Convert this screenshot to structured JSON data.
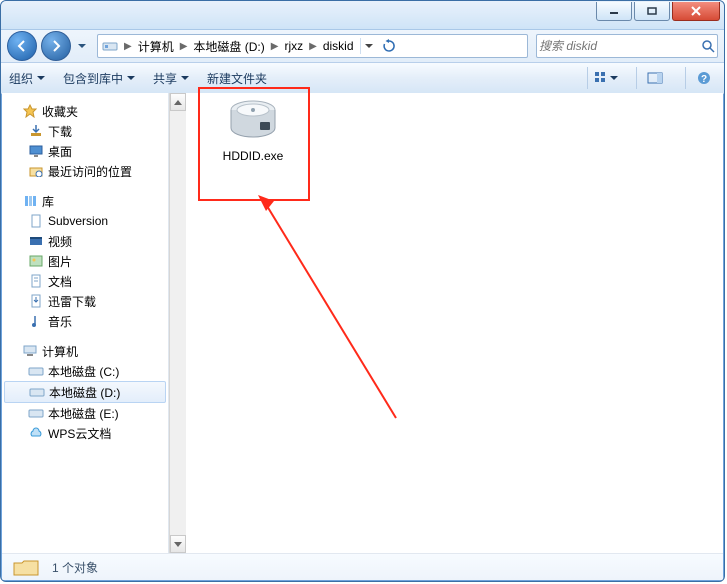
{
  "breadcrumb": {
    "items": [
      "计算机",
      "本地磁盘 (D:)",
      "rjxz",
      "diskid"
    ]
  },
  "search": {
    "placeholder": "搜索 diskid"
  },
  "cmdbar": {
    "organize": "组织",
    "include": "包含到库中",
    "share": "共享",
    "newfolder": "新建文件夹"
  },
  "sidebar": {
    "favorites": {
      "label": "收藏夹",
      "children": [
        {
          "label": "下载"
        },
        {
          "label": "桌面"
        },
        {
          "label": "最近访问的位置"
        }
      ]
    },
    "libraries": {
      "label": "库",
      "children": [
        {
          "label": "Subversion"
        },
        {
          "label": "视频"
        },
        {
          "label": "图片"
        },
        {
          "label": "文档"
        },
        {
          "label": "迅雷下载"
        },
        {
          "label": "音乐"
        }
      ]
    },
    "computer": {
      "label": "计算机",
      "children": [
        {
          "label": "本地磁盘 (C:)"
        },
        {
          "label": "本地磁盘 (D:)",
          "selected": true
        },
        {
          "label": "本地磁盘 (E:)"
        },
        {
          "label": "WPS云文档"
        }
      ]
    }
  },
  "files": [
    {
      "name": "HDDID.exe"
    }
  ],
  "status": {
    "text": "1 个对象"
  }
}
